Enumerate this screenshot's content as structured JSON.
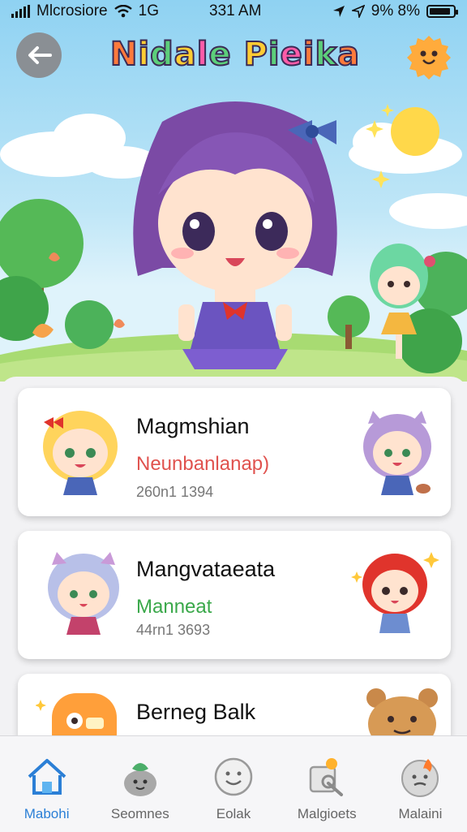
{
  "status_bar": {
    "carrier": "Mlcrosiore",
    "network": "1G",
    "time": "331 AM",
    "battery_text": "9% 8%",
    "battery_level": 0.9
  },
  "header": {
    "back_icon": "back-arrow-icon",
    "title": "Nidale Pieika",
    "mascot_icon": "orange-mascot-icon"
  },
  "characters": [
    {
      "name": "Magmshian",
      "subtitle": "Neunbanlanap)",
      "subtitle_color": "#e0524e",
      "meta": "260n1 1394"
    },
    {
      "name": "Mangvataeata",
      "subtitle": "Manneat",
      "subtitle_color": "#3aa84a",
      "meta": "44rn1 3693"
    },
    {
      "name": "Berneg Balk",
      "subtitle": "",
      "subtitle_color": "#3aa84a",
      "meta": ""
    }
  ],
  "tabs": [
    {
      "label": "Mabohi",
      "icon": "home-icon",
      "active": true
    },
    {
      "label": "Seomnes",
      "icon": "plant-buddy-icon",
      "active": false
    },
    {
      "label": "Eolak",
      "icon": "smiley-icon",
      "active": false
    },
    {
      "label": "Malgioets",
      "icon": "gadgets-icon",
      "active": false
    },
    {
      "label": "Malaini",
      "icon": "flame-face-icon",
      "active": false
    }
  ],
  "colors": {
    "accent": "#2b7fd6",
    "sky": "#8fd2f2",
    "grass": "#9ed36a"
  }
}
